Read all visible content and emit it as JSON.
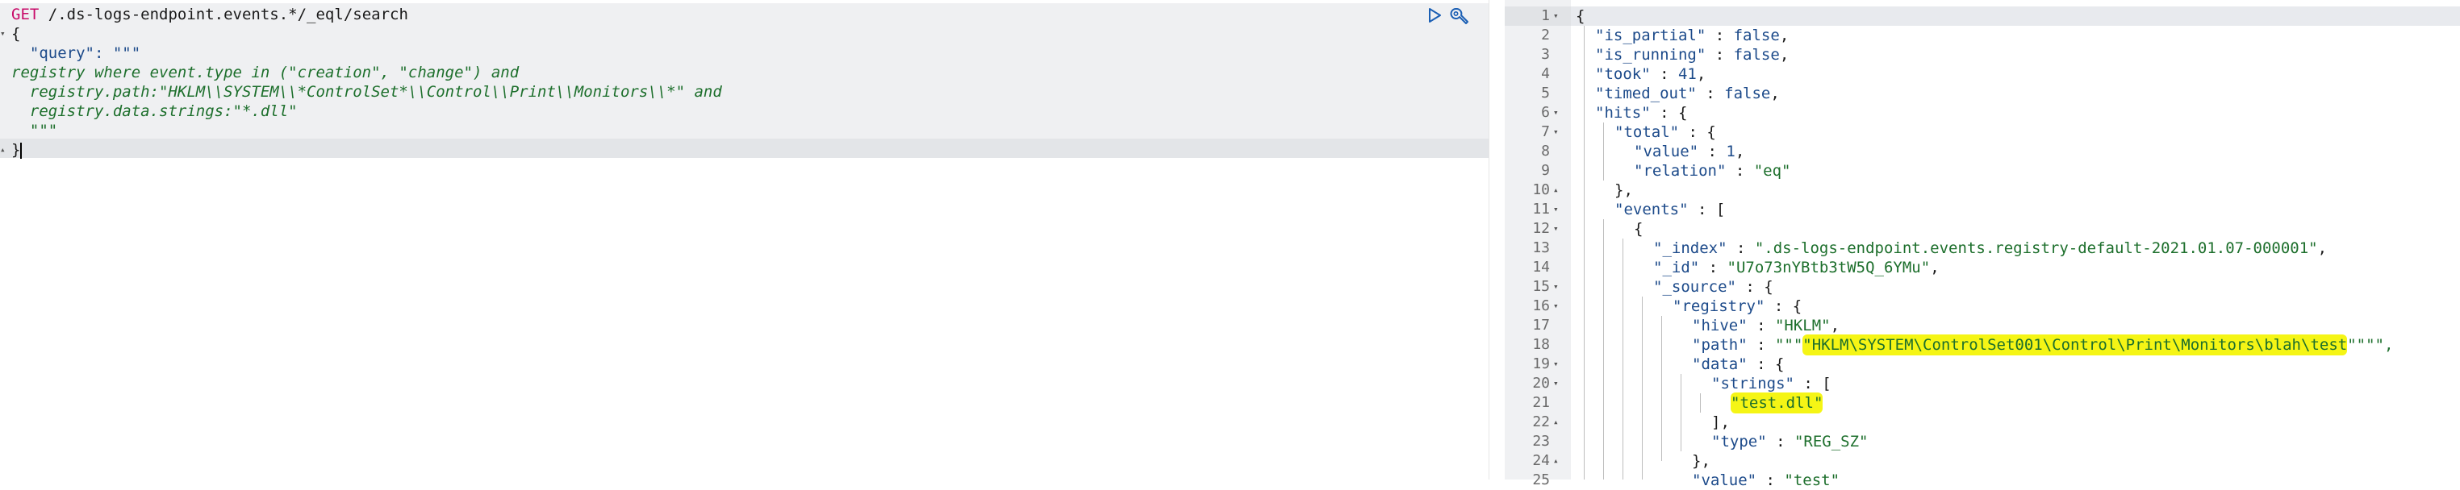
{
  "request": {
    "method": "GET",
    "path": " /.ds-logs-endpoint.events.*/_eql/search",
    "lines": {
      "open": "{",
      "query_key": "  \"query\": \"\"\"",
      "eql1": "registry where event.type in (\"creation\", \"change\") and",
      "eql2": "  registry.path:\"HKLM\\\\SYSTEM\\\\*ControlSet*\\\\Control\\\\Print\\\\Monitors\\\\*\" and",
      "eql3": "  registry.data.strings:\"*.dll\"",
      "close_q": "  \"\"\"",
      "close": "}"
    }
  },
  "response": {
    "line_numbers": [
      "1",
      "2",
      "3",
      "4",
      "5",
      "6",
      "7",
      "8",
      "9",
      "10",
      "11",
      "12",
      "13",
      "14",
      "15",
      "16",
      "17",
      "18",
      "19",
      "20",
      "21",
      "22",
      "23",
      "24",
      "25"
    ],
    "l1": "{",
    "l2_key": "\"is_partial\"",
    "l2_val": "false",
    "l3_key": "\"is_running\"",
    "l3_val": "false",
    "l4_key": "\"took\"",
    "l4_val": "41",
    "l5_key": "\"timed_out\"",
    "l5_val": "false",
    "l6_key": "\"hits\"",
    "l7_key": "\"total\"",
    "l8_key": "\"value\"",
    "l8_val": "1",
    "l9_key": "\"relation\"",
    "l9_val": "\"eq\"",
    "l10": "},",
    "l11_key": "\"events\"",
    "l12": "{",
    "l13_key": "\"_index\"",
    "l13_val": "\".ds-logs-endpoint.events.registry-default-2021.01.07-000001\"",
    "l14_key": "\"_id\"",
    "l14_val": "\"U7o73nYBtb3tW5Q_6YMu\"",
    "l15_key": "\"_source\"",
    "l16_key": "\"registry\"",
    "l17_key": "\"hive\"",
    "l17_val": "\"HKLM\"",
    "l18_key": "\"path\"",
    "l18_pre": "\"\"\"",
    "l18_hl": "\"HKLM\\SYSTEM\\ControlSet001\\Control\\Print\\Monitors\\blah\\test",
    "l18_post": "\"\"\"\",",
    "l19_key": "\"data\"",
    "l20_key": "\"strings\"",
    "l21_hl": "\"test.dll\"",
    "l22": "],",
    "l23_key": "\"type\"",
    "l23_val": "\"REG_SZ\"",
    "l24": "},",
    "l25_key": "\"value\"",
    "l25_val": "\"test\""
  }
}
